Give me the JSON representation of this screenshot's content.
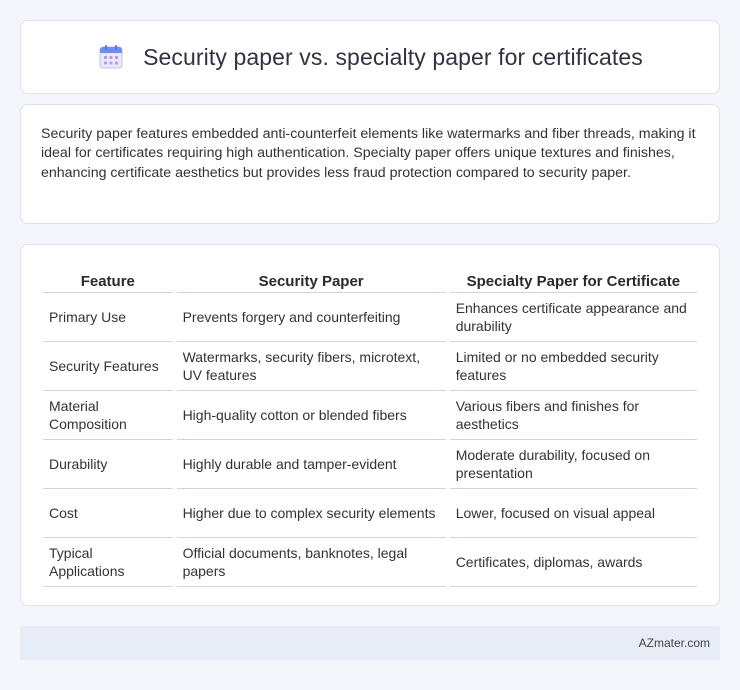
{
  "header": {
    "title": "Security paper vs. specialty paper for certificates",
    "icon": "calendar-icon",
    "icon_colors": {
      "top": "#6d8df0",
      "body": "#ece8fb",
      "dots": "#b39af0"
    }
  },
  "intro": {
    "text": "Security paper features embedded anti-counterfeit elements like watermarks and fiber threads, making it ideal for certificates requiring high authentication. Specialty paper offers unique textures and finishes, enhancing certificate aesthetics but provides less fraud protection compared to security paper."
  },
  "table": {
    "headers": [
      "Feature",
      "Security Paper",
      "Specialty Paper for Certificate"
    ],
    "rows": [
      [
        "Primary Use",
        "Prevents forgery and counterfeiting",
        "Enhances certificate appearance and durability"
      ],
      [
        "Security Features",
        "Watermarks, security fibers, microtext, UV features",
        "Limited or no embedded security features"
      ],
      [
        "Material Composition",
        "High-quality cotton or blended fibers",
        "Various fibers and finishes for aesthetics"
      ],
      [
        "Durability",
        "Highly durable and tamper-evident",
        "Moderate durability, focused on presentation"
      ],
      [
        "Cost",
        "Higher due to complex security elements",
        "Lower, focused on visual appeal"
      ],
      [
        "Typical Applications",
        "Official documents, banknotes, legal papers",
        "Certificates, diplomas, awards"
      ]
    ]
  },
  "footer": {
    "brand": "AZmater.com"
  }
}
